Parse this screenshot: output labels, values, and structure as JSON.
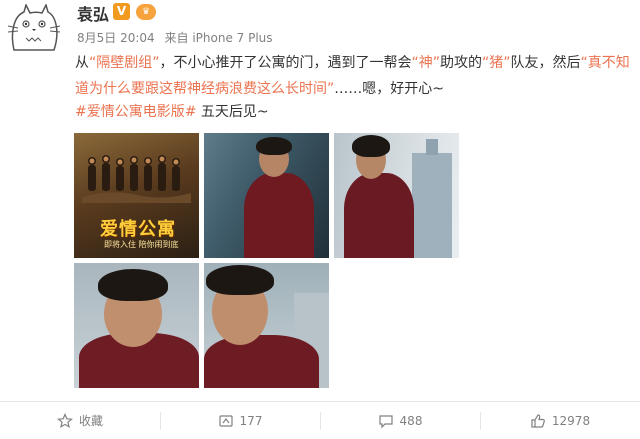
{
  "post": {
    "username": "袁弘",
    "vip_badge": "V",
    "level_badge": "♛",
    "date": "8月5日 20:04",
    "source": "来自 iPhone 7 Plus",
    "text": {
      "seg1": "从",
      "link1": "“隔壁剧组”",
      "seg2": "，不小心推开了公寓的门，遇到了一帮会",
      "link2": "“神”",
      "seg3": "助攻的",
      "link3": "“猪”",
      "seg4": "队友，然后",
      "link4": "“真不知道为什么要跟这帮神经病浪费这么长时间”",
      "seg5": "……嗯，好开心~"
    },
    "hashtag": "#爱情公寓电影版#",
    "hashtag_suffix": " 五天后见~"
  },
  "images": {
    "poster_title": "爱情公寓",
    "poster_sub": "即将入住 陪你闹到底"
  },
  "actions": {
    "favorite": "收藏",
    "repost": "177",
    "comment": "488",
    "like": "12978"
  },
  "colors": {
    "link": "#eb7350",
    "text": "#333333",
    "meta": "#808080",
    "vip": "#f29a1f"
  },
  "icons": [
    "avatar-totoro-icon",
    "vip-icon",
    "star-icon",
    "repost-icon",
    "comment-icon",
    "like-icon"
  ]
}
